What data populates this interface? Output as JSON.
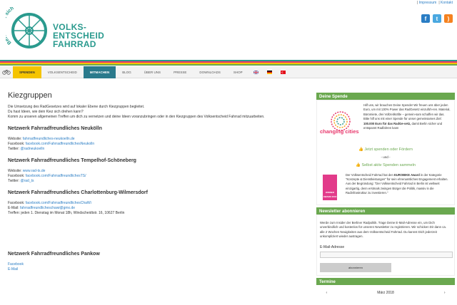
{
  "toplinks": [
    "Impressum",
    "Kontakt"
  ],
  "logo": {
    "arc_text": "Berlin dreht sich",
    "line1": "VOLKS-",
    "line2": "ENTSCHEID",
    "line3": "FAHRRAD"
  },
  "stripe_colors": [
    "#2a9a8e",
    "#e8386d",
    "#f5c400",
    "#6aa84f"
  ],
  "nav": {
    "items": [
      {
        "label": "Spenden",
        "style": "spenden"
      },
      {
        "label": "Volksentscheid",
        "style": ""
      },
      {
        "label": "Mitmachen",
        "style": "active"
      },
      {
        "label": "Blog",
        "style": ""
      },
      {
        "label": "Über uns",
        "style": ""
      },
      {
        "label": "Presse",
        "style": ""
      },
      {
        "label": "Downloads",
        "style": ""
      },
      {
        "label": "Shop",
        "style": ""
      }
    ]
  },
  "main": {
    "title": "Kiezgruppen",
    "intro1": "Die Umsetzung des RadGesetzes wird auf lokaler Ebene durch Kiezgruppen begleitet.",
    "intro2": "Du hast Ideen, wie dein Kiez sich drehen kann?",
    "intro3": "Komm zu unseren allgemeinen Treffen um dich zu vernetzen und deine Ideen voranzubringen oder in den Kiezgruppen des Volksentscheid Fahrrad mitzuarbeiten.",
    "groups": [
      {
        "name": "Netzwerk Fahrradfreundliches Neukölln",
        "website_label": "Website:",
        "website": "fahrradfreundliches-neukoelln.de",
        "facebook_label": "Facebook:",
        "facebook": "facebook.com/FahrradfreundlichesNeukolln",
        "twitter_label": "Twitter:",
        "twitter": "@radneukoelln"
      },
      {
        "name": "Netzwerk Fahrradfreundliches Tempelhof-Schöneberg",
        "website_label": "Website:",
        "website": "www.rad-ts.de",
        "facebook_label": "Facebook:",
        "facebook": "facebook.com/FahrradfreundlichesTS/",
        "twitter_label": "Twitter:",
        "twitter": "@rad_ts"
      }
    ],
    "g3": {
      "name": "Netzwerk Fahrradfreundliches Charlottenburg-Wilmersdorf",
      "facebook_label": "Facebook:",
      "facebook": "facebook.com/FahrradfreundlichesChaWi",
      "email_label": "E-Mail:",
      "email": "fahrradfreundlicheschawi@gmx.de",
      "treffen": "Treffen: jeden 1. Dienstag im Monat 18h, Windscheidtstr. 16, 10627 Berlin"
    },
    "g4": {
      "name": "Netzwerk Fahrradfreundliches Pankow",
      "facebook": "Facebook",
      "email": "E-Mail"
    }
  },
  "sidebar": {
    "spende_head": "Deine Spende",
    "spende_text_1": "Hilf uns, wir brauchen Deine Spende! Wir freuen uns über jeden Euro, um mit 130% Power das RadGesetz einzufüh-ren. Material, Büromiete, drei Vollzeitkräfte – gemein-sam schaffen wir das. Bitte hilf uns mit einer Spende für unser gemeinsames Ziel:",
    "spende_strong": "100.000 Euro für das RadGe-setz,",
    "spende_text_2": "damit Berlin sicher und entspannt Radfahren kann",
    "cc_label": "changing cities",
    "cta1": "Jetzt spenden oder Fördern",
    "und": "- und -",
    "cta2": "Selbst aktiv Spenden sammeln",
    "award_text_1": "Der Volksentscheid Fahrrad hat den",
    "award_strong": "EUROBIKE Award",
    "award_text_2": "in der Kategorie \"Konzepte & Dienstleistungen\" für sein ehrenamtliches Engagement erhalten. Aus der Begründung: \"Der Volksentscheid Fahrrad in Berlin ist weltweit einzigartig, denn erstmals zwingen Bürger die Politik, massiv in die Radinfrastruktur zu investieren.\"",
    "award_img_label": "WINNER",
    "award_img_sub": "AWARD 2016",
    "news_head": "Newsletter abonnieren",
    "news_text": "Werde zum Insider der Berliner Radpolitik. Trage Deine E-Mail-Adresse ein, um Dich unverbindlich und kostenlos für unseren Newsletter zu registrieren. Wir schicken Dir dann ca. alle 2 Wochen Neuigkeiten aus dem Volksentscheid Fahrrad. Du kannst Dich jederzeit unkompliziert wieder austragen.",
    "email_label": "E-Mail-Adresse",
    "submit": "abonnieren",
    "termine_head": "Termine",
    "cal_prev": "‹",
    "cal_month": "März 2018",
    "cal_next": "›"
  }
}
